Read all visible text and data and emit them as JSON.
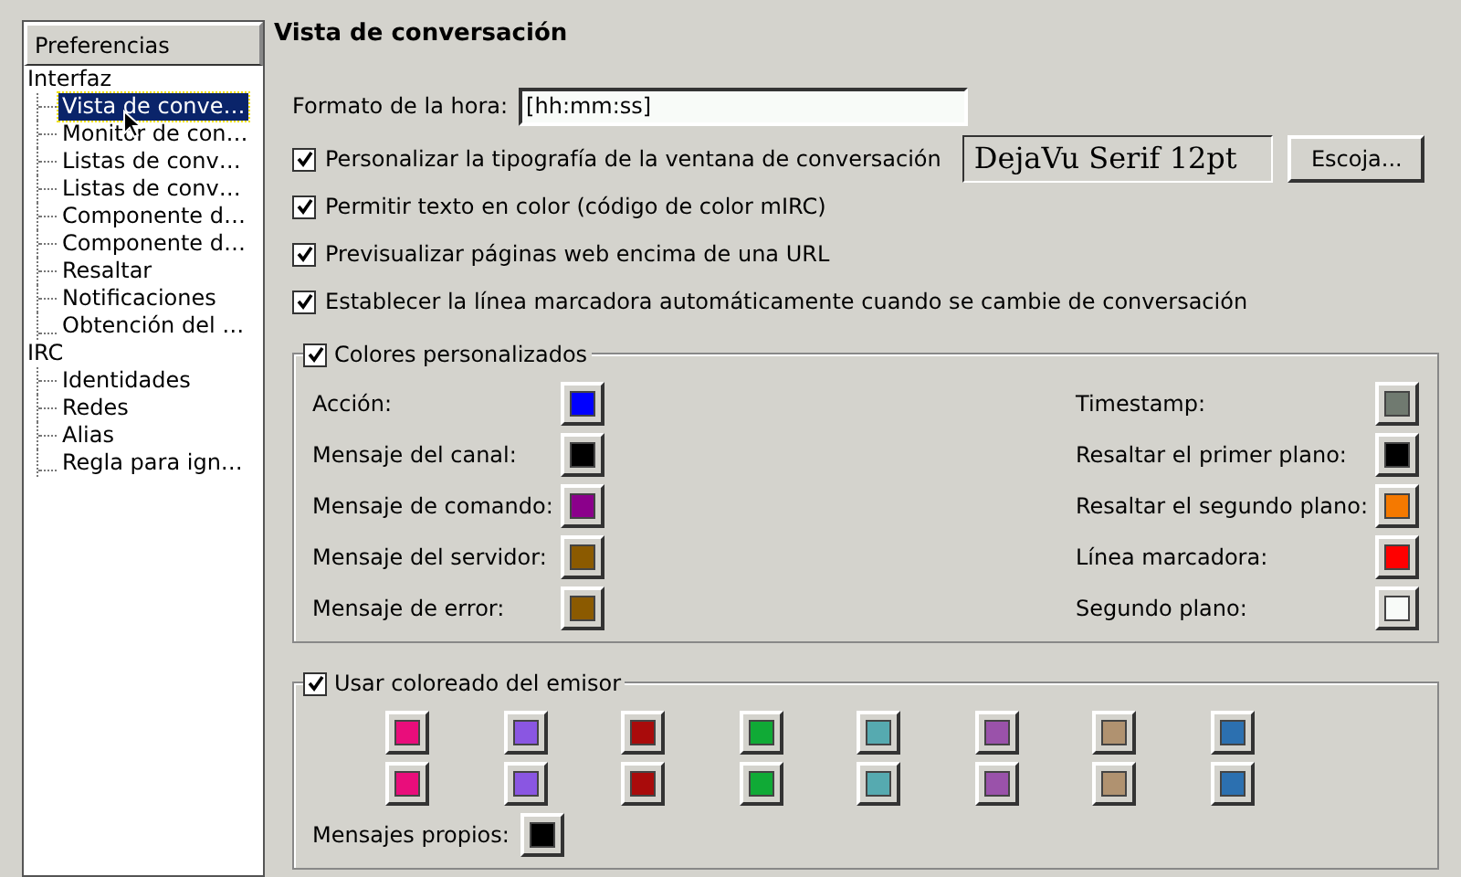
{
  "sidebar": {
    "header": "Preferencias",
    "tree": [
      {
        "label": "Interfaz",
        "selected": false,
        "children": [
          {
            "label": "Vista de conve…",
            "selected": true
          },
          {
            "label": "Monitor de con…",
            "selected": false
          },
          {
            "label": "Listas de conv…",
            "selected": false
          },
          {
            "label": "Listas de conv…",
            "selected": false
          },
          {
            "label": "Componente d…",
            "selected": false
          },
          {
            "label": "Componente d…",
            "selected": false
          },
          {
            "label": "Resaltar",
            "selected": false
          },
          {
            "label": "Notificaciones",
            "selected": false
          },
          {
            "label": "Obtención del …",
            "selected": false
          }
        ]
      },
      {
        "label": "IRC",
        "selected": false,
        "children": [
          {
            "label": "Identidades",
            "selected": false
          },
          {
            "label": "Redes",
            "selected": false
          },
          {
            "label": "Alias",
            "selected": false
          },
          {
            "label": "Regla para ign…",
            "selected": false
          }
        ]
      }
    ]
  },
  "page": {
    "title": "Vista de conversación",
    "time_format": {
      "label": "Formato de la hora:",
      "value": "[hh:mm:ss]"
    },
    "options": [
      {
        "label": "Personalizar la tipografía de la ventana de conversación",
        "checked": true,
        "font": "DejaVu Serif 12pt",
        "button": "Escoja..."
      },
      {
        "label": "Permitir texto en color (código de color mIRC)",
        "checked": true
      },
      {
        "label": "Previsualizar páginas web encima de una URL",
        "checked": true
      },
      {
        "label": "Establecer la línea marcadora automáticamente cuando se cambie de conversación",
        "checked": true
      }
    ],
    "custom_colors": {
      "label": "Colores personalizados",
      "checked": true,
      "left": [
        {
          "label": "Acción:",
          "color": "#0000ff"
        },
        {
          "label": "Mensaje del canal:",
          "color": "#000000"
        },
        {
          "label": "Mensaje de comando:",
          "color": "#8b008b"
        },
        {
          "label": "Mensaje del servidor:",
          "color": "#8b5a00"
        },
        {
          "label": "Mensaje de error:",
          "color": "#8b5a00"
        }
      ],
      "right": [
        {
          "label": "Timestamp:",
          "color": "#707a70"
        },
        {
          "label": "Resaltar el primer plano:",
          "color": "#000000"
        },
        {
          "label": "Resaltar el segundo plano:",
          "color": "#f57900"
        },
        {
          "label": "Línea marcadora:",
          "color": "#ff0000"
        },
        {
          "label": "Segundo plano:",
          "color": "#f8fbf8"
        }
      ]
    },
    "sender_colors": {
      "label": "Usar coloreado del emisor",
      "checked": true,
      "swatches": [
        {
          "color": "#e90d7b"
        },
        {
          "color": "#8a56e2"
        },
        {
          "color": "#a90b0b"
        },
        {
          "color": "#10aa36"
        },
        {
          "color": "#56aab0"
        },
        {
          "color": "#9a52aa"
        },
        {
          "color": "#b09270"
        },
        {
          "color": "#2c70b0"
        },
        {
          "color": "#e90d7b"
        },
        {
          "color": "#8a56e2"
        },
        {
          "color": "#a90b0b"
        },
        {
          "color": "#10aa36"
        },
        {
          "color": "#56aab0"
        },
        {
          "color": "#9a52aa"
        },
        {
          "color": "#b09270"
        },
        {
          "color": "#2c70b0"
        }
      ],
      "own": {
        "label": "Mensajes propios:",
        "color": "#000000"
      }
    }
  }
}
